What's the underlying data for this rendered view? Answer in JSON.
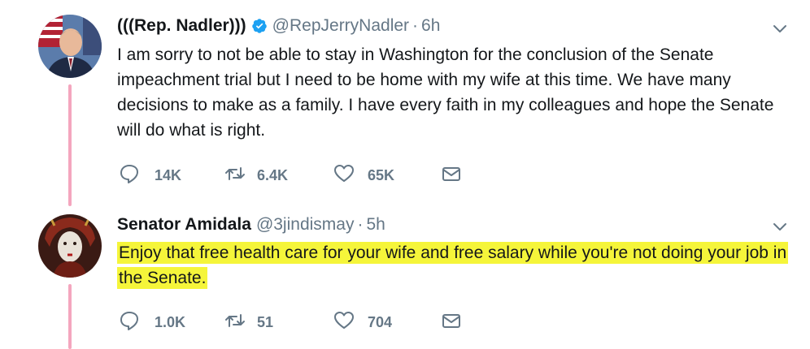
{
  "tweets": [
    {
      "name": "(((Rep. Nadler)))",
      "verified": true,
      "handle": "@RepJerryNadler",
      "separator": "·",
      "time": "6h",
      "text": "I am sorry to not be able to stay in Washington for the conclusion of the Senate impeachment trial but I need to be home with my wife at this time. We have many decisions to make as a family. I have every faith in my colleagues and hope the Senate will do what is right.",
      "highlighted": false,
      "replies": "14K",
      "retweets": "6.4K",
      "likes": "65K"
    },
    {
      "name": "Senator Amidala",
      "verified": false,
      "handle": "@3jindismay",
      "separator": "·",
      "time": "5h",
      "text": "Enjoy that free health care for your wife and free salary while you're not doing your job in the Senate.",
      "highlighted": true,
      "highlight_color": "#f5f53a",
      "replies": "1.0K",
      "retweets": "51",
      "likes": "704"
    }
  ],
  "colors": {
    "thread_line": "#f4a6be",
    "verified_badge": "#1da1f2",
    "muted_text": "#657786"
  }
}
